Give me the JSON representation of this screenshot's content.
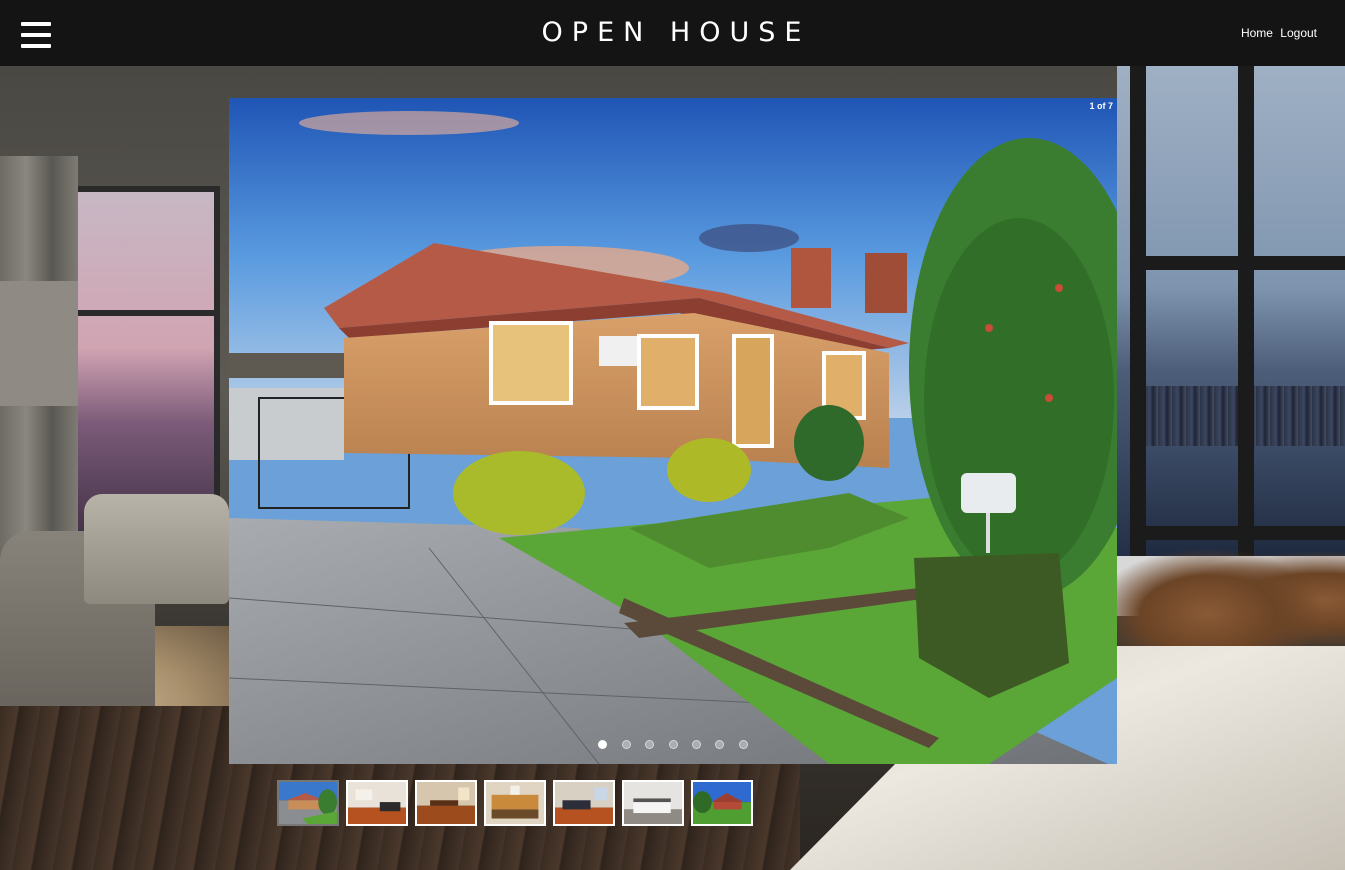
{
  "header": {
    "title": "OPEN HOUSE",
    "nav": [
      {
        "label": "Home"
      },
      {
        "label": "Logout"
      }
    ],
    "menu_icon": "hamburger-menu-icon"
  },
  "gallery": {
    "counter": "1 of 7",
    "current_index": 1,
    "total": 7,
    "main_photo": "exterior-brick-house",
    "thumbnails": [
      {
        "name": "exterior-front",
        "active": true
      },
      {
        "name": "living-room",
        "active": false
      },
      {
        "name": "dining-room",
        "active": false
      },
      {
        "name": "kitchen",
        "active": false
      },
      {
        "name": "lounge",
        "active": false
      },
      {
        "name": "bedroom",
        "active": false
      },
      {
        "name": "backyard",
        "active": false
      }
    ]
  },
  "colors": {
    "header_bg": "#141414",
    "accent": "#ffffff"
  }
}
